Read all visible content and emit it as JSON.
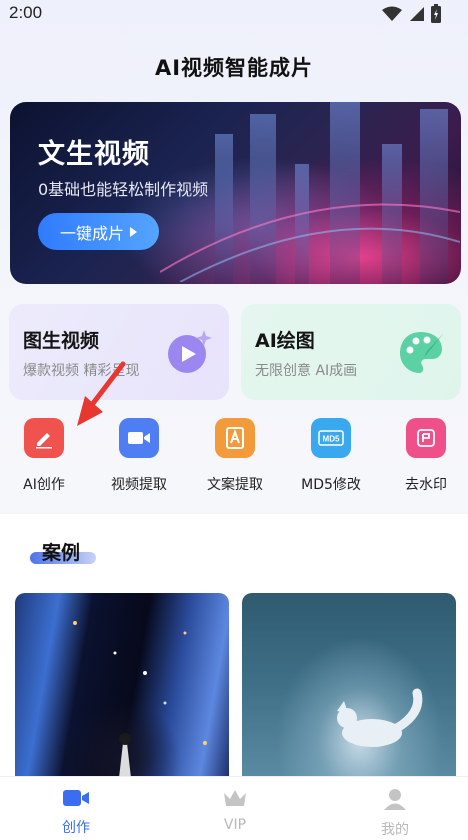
{
  "status": {
    "time": "2:00"
  },
  "app": {
    "title": "AI视频智能成片"
  },
  "hero": {
    "title": "文生视频",
    "subtitle": "0基础也能轻松制作视频",
    "button": "一键成片"
  },
  "cards": [
    {
      "title": "图生视频",
      "subtitle": "爆款视频 精彩呈现"
    },
    {
      "title": "AI绘图",
      "subtitle": "无限创意 AI成画"
    }
  ],
  "tools": [
    {
      "label": "AI创作",
      "icon": "pen-icon",
      "color": "#f0524d"
    },
    {
      "label": "视频提取",
      "icon": "video-camera-icon",
      "color": "#4f7ef3"
    },
    {
      "label": "文案提取",
      "icon": "document-a-icon",
      "color": "#f39a3a"
    },
    {
      "label": "MD5修改",
      "icon": "md5-icon",
      "color": "#3aa8ef"
    },
    {
      "label": "去水印",
      "icon": "stamp-icon",
      "color": "#f0508a"
    }
  ],
  "cases": {
    "title": "案例"
  },
  "tabs": [
    {
      "label": "创作",
      "active": true,
      "color": "#3a6df0"
    },
    {
      "label": "VIP",
      "active": false,
      "color": "#b8b8b8"
    },
    {
      "label": "我的",
      "active": false,
      "color": "#b8b8b8"
    }
  ]
}
